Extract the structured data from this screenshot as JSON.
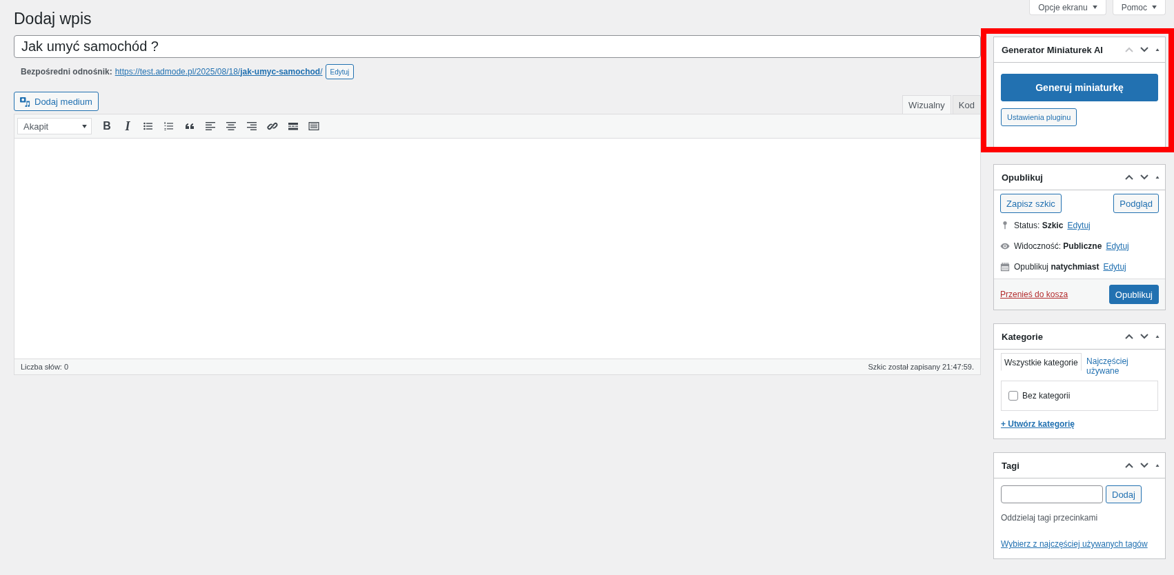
{
  "screen_options": [
    {
      "label": "Opcje ekranu"
    },
    {
      "label": "Pomoc"
    }
  ],
  "page_title": "Dodaj wpis",
  "post_title": {
    "value": "Jak umyć samochód ?"
  },
  "permalink": {
    "label": "Bezpośredni odnośnik:",
    "url": "https://test.admode.pl/2025/08/18/**jak-umyc-samochod**/",
    "edit_button": "Edytuj"
  },
  "add_media": "Dodaj medium",
  "editor": {
    "tabs": [
      {
        "label": "Wizualny",
        "selected": true
      },
      {
        "label": "Kod",
        "selected": false
      }
    ],
    "format_select": "Akapit",
    "toolbar": [
      {
        "kind": "bold",
        "glyph": "B"
      },
      {
        "kind": "italic",
        "glyph": "I"
      },
      {
        "kind": "bullet-list"
      },
      {
        "kind": "numbered-list"
      },
      {
        "kind": "quote"
      },
      {
        "kind": "align-left"
      },
      {
        "kind": "align-center"
      },
      {
        "kind": "align-right"
      },
      {
        "kind": "link"
      },
      {
        "kind": "more"
      },
      {
        "kind": "keyboard"
      }
    ],
    "word_count": "Liczba słów: 0",
    "autosave": "Szkic został zapisany 21:47:59."
  },
  "generator_box": {
    "title": "Generator Miniaturek AI",
    "highlighted": true,
    "up_disabled": true,
    "primary_button": "Generuj miniaturkę",
    "secondary_button": "Ustawienia pluginu"
  },
  "publish_box": {
    "title": "Opublikuj",
    "up_disabled": false,
    "save_draft": "Zapisz szkic",
    "preview": "Podgląd",
    "rows": [
      {
        "kind": "status",
        "text": "Status: **Szkic**",
        "link": "Edytuj"
      },
      {
        "kind": "visibility",
        "text": "Widoczność: **Publiczne**",
        "link": "Edytuj"
      },
      {
        "kind": "schedule",
        "text": "Opublikuj **natychmiast**",
        "link": "Edytuj"
      }
    ],
    "trash": "Przenieś do kosza",
    "publish": "Opublikuj"
  },
  "categories_box": {
    "title": "Kategorie",
    "up_disabled": false,
    "tabs": [
      {
        "label": "Wszystkie kategorie",
        "selected": true
      },
      {
        "label": "Najczęściej używane",
        "selected": false
      }
    ],
    "items": [
      {
        "label": "Bez kategorii",
        "checked": false
      }
    ],
    "add_link": "+ Utwórz kategorię"
  },
  "tags_box": {
    "title": "Tagi",
    "up_disabled": false,
    "add_button": "Dodaj",
    "hint": "Oddzielaj tagi przecinkami",
    "choose_link": "Wybierz z najczęściej używanych tagów"
  }
}
